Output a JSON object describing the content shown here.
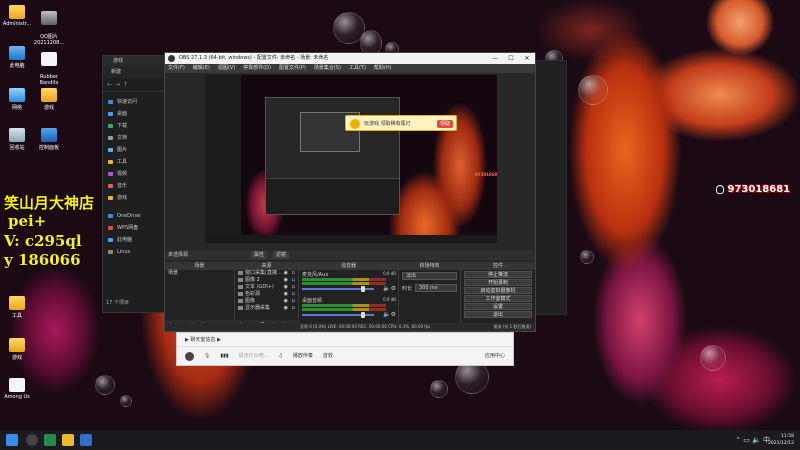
{
  "desktop": {
    "icons": [
      {
        "label": "Administr..."
      },
      {
        "label": "QQ图片\n20211208..."
      },
      {
        "label": "此电脑"
      },
      {
        "label": "Rubber\nBandits"
      },
      {
        "label": "网络"
      },
      {
        "label": "游戏"
      },
      {
        "label": "回收站"
      },
      {
        "label": "控制面板"
      },
      {
        "label": "工具"
      },
      {
        "label": "游戏"
      },
      {
        "label": "Among Us"
      }
    ],
    "overlay": {
      "line1": "笑山月大神店",
      "line2": "pei+",
      "line3": "V:  c295ql",
      "line4": "y   186066"
    },
    "qq_number": "973018681"
  },
  "explorer": {
    "title": "游戏",
    "new_label": "新建",
    "items": [
      {
        "label": "快速访问"
      },
      {
        "label": "桌面"
      },
      {
        "label": "下载"
      },
      {
        "label": "文档"
      },
      {
        "label": "图片"
      },
      {
        "label": "工具"
      },
      {
        "label": "视频"
      },
      {
        "label": "音乐"
      },
      {
        "label": "游戏"
      },
      {
        "label": "OneDrive"
      },
      {
        "label": "WPS网盘"
      },
      {
        "label": "此电脑"
      },
      {
        "label": "Linux"
      }
    ],
    "count": "17 个项目"
  },
  "obs": {
    "title": "OBS 27.1.3 (64-bit, windows) - 配置文件: 未命名 - 场景: 未命名",
    "menu": [
      "文件(F)",
      "编辑(E)",
      "视图(V)",
      "停靠部件(D)",
      "配置文件(P)",
      "场景集合(S)",
      "工具(T)",
      "帮助(H)"
    ],
    "window_controls": [
      "—",
      "☐",
      "✕"
    ],
    "preview": {
      "ad_text": "玩游戏  领取稀有尾灯",
      "ad_button": "领取",
      "qq_mini": "973018681"
    },
    "scene_bar": {
      "label": "未选择源",
      "tabs": [
        "属性",
        "滤镜"
      ]
    },
    "docks": {
      "scenes": {
        "header": "场景",
        "items": [
          "场景"
        ]
      },
      "sources": {
        "header": "来源",
        "items": [
          "窗口采集(直接...",
          "图像 2",
          "文本 (GDI+)",
          "色彩源",
          "图像",
          "显示器采集"
        ]
      },
      "mixer": {
        "header": "混音器",
        "channels": [
          {
            "name": "麦克风/Aux",
            "db": "0.0 dB"
          },
          {
            "name": "桌面音频",
            "db": "0.0 dB"
          }
        ]
      },
      "transitions": {
        "header": "转场特效",
        "type": "淡出",
        "duration_label": "时长",
        "duration": "300 ms"
      },
      "controls": {
        "header": "控件",
        "buttons": [
          "停止推流",
          "开始录制",
          "启动虚拟摄像机",
          "工作室模式",
          "设置",
          "退出"
        ]
      }
    },
    "status": "丢帧 0 (0.0%)  LIVE: 00:00:00  REC: 00:00:00  CPU: 0.3%, 60.00 fps",
    "status_right": "推流 (仅 1 秒后推流)"
  },
  "qqbar": {
    "top_text": "▶ 聊天室信息 ▶",
    "bottom": [
      "说点什么吧...",
      "播放伴奏",
      "音效",
      "应用中心"
    ]
  },
  "taskbar": {
    "clock_time": "11:58",
    "clock_date": "2021/12/12"
  }
}
